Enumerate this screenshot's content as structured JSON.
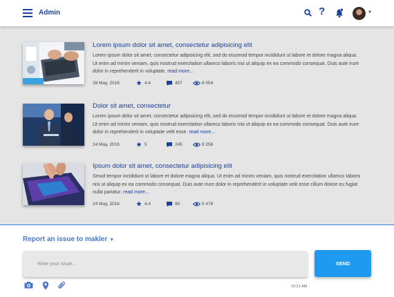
{
  "header": {
    "title": "Admin",
    "icons": [
      "hamburger-menu-icon",
      "search-icon",
      "help-icon",
      "notification-bell-icon",
      "user-avatar"
    ],
    "help_glyph": "?"
  },
  "articles": [
    {
      "title": "Lorem ipsum dolor sit amet, consectetur adipisicing elit",
      "description": "Lorem ipsum dolor sit amet, consectetur adipisicing elit, sed do eiusmod tempor incididunt ut labore et dolore magna aliqua. Ut enim ad minim veniam, quis nostrud exercitation ullamco laboris nisi ut aliquip ex ea commodo consequat. Duis aute irure dolor in reprehenderit in voluptate.",
      "read_more": "read more...",
      "date": "26 May, 2016",
      "rating": "4.4",
      "comments": "457",
      "views": "8 054"
    },
    {
      "title": "Dolor sit amet, consectetur",
      "description": "Lorem ipsum dolor sit amet, consectetur adipisicing elit, sed do eiusmod tempor incididunt ut labore et dolore magna aliqua. Ut enim ad minim veniam, quis nostrud exercitation ullamco laboris nisi ut aliquip ex ea commodo consequat. Duis aute irure dolor in reprehenderit in voluptate velit esse.",
      "read_more": "read more...",
      "date": "24 May, 2016",
      "rating": "5",
      "comments": "245",
      "views": "9 256"
    },
    {
      "title": "Ipsum dolor sit amet, consectetur adipisicing elit",
      "description": "Smod tempor incididunt ut labore et dolore magna aliqua. Ut enim ad minim veniam, quis nostrud exercitation ullamco laboris nisi ut aliquip ex ea commodo consequat. Duis aute irure dolor in reprehenderit in voluptate velit esse cillum dolore eu fugiat nulla pariatur.",
      "read_more": "read more...",
      "date": "24 May, 2016",
      "rating": "4.4",
      "comments": "90",
      "views": "5 478"
    }
  ],
  "report": {
    "label": "Report an issue to makler",
    "caret": "▼",
    "input_placeholder": "Write your issue...",
    "send_label": "SEND",
    "timestamp": "10:21 AM",
    "attach_icons": [
      "camera-icon",
      "location-pin-icon",
      "paperclip-icon"
    ]
  },
  "colors": {
    "brand": "#1a3f9c",
    "send_button": "#1e9bf0",
    "link": "#4a78c8",
    "background": "#e5e5e5"
  }
}
